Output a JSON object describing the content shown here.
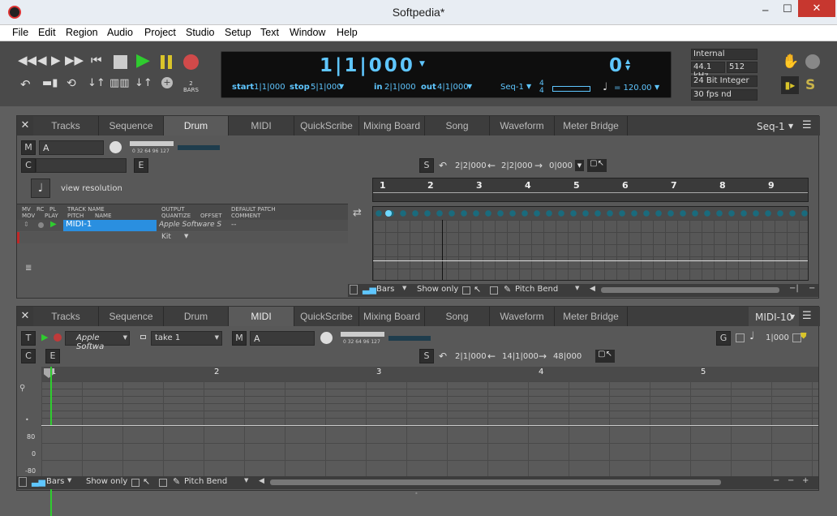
{
  "window": {
    "title": "Softpedia*",
    "minimize": "─",
    "maximize": "☐",
    "close": "✕"
  },
  "menu": [
    "File",
    "Edit",
    "Region",
    "Audio",
    "Project",
    "Studio",
    "Setup",
    "Text",
    "Window",
    "Help"
  ],
  "transport": {
    "main_time": "1|1|000",
    "main_time_2": "0",
    "start_label": "start",
    "start_value": "1|1|000",
    "stop_label": "stop",
    "stop_value": "5|1|000",
    "in_label": "in",
    "in_value": "2|1|000",
    "out_label": "out",
    "out_value": "4|1|000",
    "seq": "Seq-1",
    "meter_top": "4",
    "meter_bottom": "4",
    "tempo": "= 120.00",
    "bars_label": "2\nBARS"
  },
  "sync": {
    "source": "Internal",
    "rate": "44.1 kHz",
    "buffer": "512",
    "bit_depth": "24 Bit Integer",
    "fps": "30 fps nd"
  },
  "top_panel": {
    "tabs": [
      "Tracks",
      "Sequence",
      "Drum",
      "MIDI",
      "QuickScribe",
      "Mixing Board",
      "Song",
      "Waveform",
      "Meter Bridge"
    ],
    "active_tab": "Drum",
    "seq_select": "Seq-1",
    "m_label": "M",
    "a_label": "A",
    "c_label": "C",
    "e_label": "E",
    "view_resolution": "view resolution",
    "s_label": "S",
    "nav_pos1": "2|2|000",
    "nav_pos2": "2|2|000",
    "nav_pos3": "0|000",
    "fader_scale": "0 32 64 96 127",
    "headers": {
      "mv": "MV",
      "mov": "MOV",
      "rc": "RC",
      "pl": "PL",
      "play": "PLAY",
      "track_name": "TRACK NAME",
      "pitch": "PITCH",
      "name": "NAME",
      "output": "OUTPUT",
      "quantize": "QUANTIZE",
      "offset": "OFFSET",
      "default_patch": "DEFAULT PATCH",
      "comment": "COMMENT"
    },
    "track": {
      "name": "MIDI-1",
      "output": "Apple Software S",
      "patch": "--",
      "kit": "Kit"
    },
    "ruler": [
      "1",
      "2",
      "3",
      "4",
      "5",
      "6",
      "7",
      "8",
      "9"
    ],
    "bottom": {
      "bars": "Bars",
      "show_only": "Show only",
      "pitch_bend": "Pitch Bend"
    }
  },
  "bottom_panel": {
    "tabs": [
      "Tracks",
      "Sequence",
      "Drum",
      "MIDI",
      "QuickScribe",
      "Mixing Board",
      "Song",
      "Waveform",
      "Meter Bridge"
    ],
    "active_tab": "MIDI",
    "seq_select": "MIDI-10",
    "t_label": "T",
    "instrument": "Apple Softwa",
    "take": "take 1",
    "m_label": "M",
    "a_label": "A",
    "c_label": "C",
    "e_label": "E",
    "g_label": "G",
    "g_value": "1|000",
    "s_label": "S",
    "nav_pos1": "2|1|000",
    "nav_pos2": "14|1|000",
    "nav_pos3": "48|000",
    "fader_scale": "0 32 64 96 127",
    "ruler": [
      "1",
      "2",
      "3",
      "4",
      "5"
    ],
    "velocity": [
      "80",
      "0",
      "-80"
    ],
    "bottom": {
      "bars": "Bars",
      "show_only": "Show only",
      "pitch_bend": "Pitch Bend"
    }
  },
  "colors": {
    "accent": "#5fc6ff",
    "play": "#2fcc2f",
    "pause": "#d9c42a",
    "record": "#d04a4a"
  }
}
